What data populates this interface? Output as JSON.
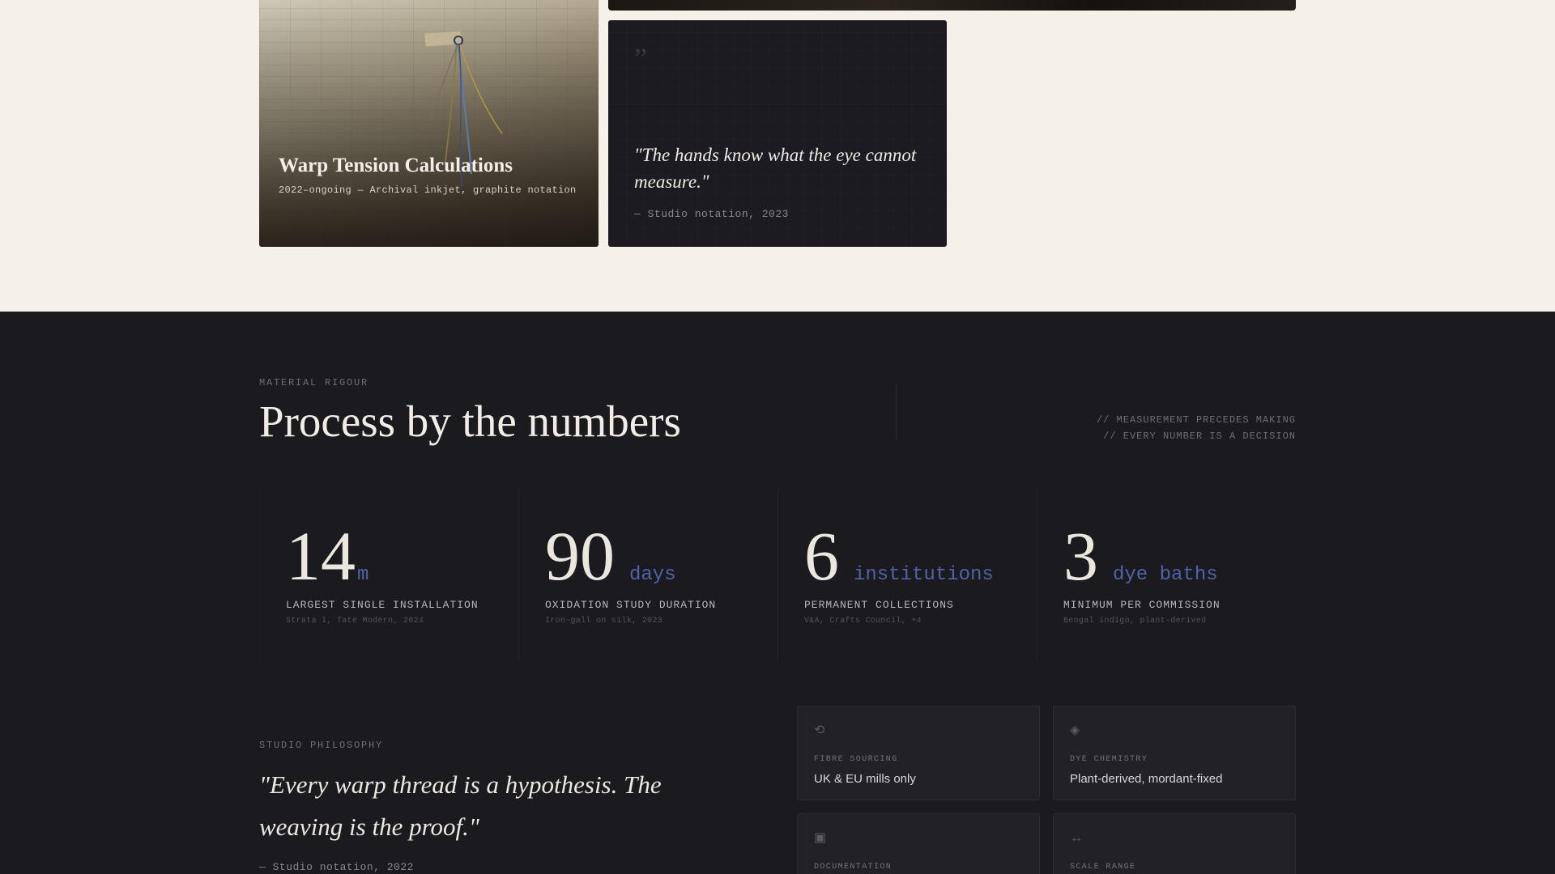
{
  "gallery": {
    "photo_card": {
      "title": "Warp Tension Calculations",
      "meta": "2022–ongoing — Archival inkjet, graphite notation"
    },
    "quote_card": {
      "mark": "”",
      "text": "\"The hands know what the eye cannot measure.\"",
      "source": "— Studio notation, 2023"
    }
  },
  "process": {
    "eyebrow": "MATERIAL RIGOUR",
    "title": "Process by the numbers",
    "notes": [
      "// MEASUREMENT PRECEDES MAKING",
      "// EVERY NUMBER IS A DECISION"
    ],
    "stats": [
      {
        "value": "14",
        "unit": "m",
        "label": "LARGEST SINGLE INSTALLATION",
        "sub": "Strata I, Tate Modern, 2024"
      },
      {
        "value": "90",
        "unit": "days",
        "label": "OXIDATION STUDY DURATION",
        "sub": "Iron-gall on silk, 2023"
      },
      {
        "value": "6",
        "unit": "institutions",
        "label": "PERMANENT COLLECTIONS",
        "sub": "V&A, Crafts Council, +4"
      },
      {
        "value": "3",
        "unit": "dye baths",
        "label": "MINIMUM PER COMMISSION",
        "sub": "Bengal indigo, plant-derived"
      }
    ]
  },
  "philosophy": {
    "eyebrow": "STUDIO PHILOSOPHY",
    "quote": "\"Every warp thread is a hypothesis. The weaving is the proof.\"",
    "source": "— Studio notation, 2022",
    "specs": [
      {
        "icon": "cycle-icon",
        "glyph": "⟲",
        "label": "FIBRE SOURCING",
        "value": "UK & EU mills only"
      },
      {
        "icon": "diamond-icon",
        "glyph": "◈",
        "label": "DYE CHEMISTRY",
        "value": "Plant-derived, mordant-fixed"
      },
      {
        "icon": "square-icon",
        "glyph": "▣",
        "label": "DOCUMENTATION",
        "value": ""
      },
      {
        "icon": "arrows-icon",
        "glyph": "↔",
        "label": "SCALE RANGE",
        "value": ""
      }
    ]
  },
  "colors": {
    "cream": "#f5f0e8",
    "dark": "#1b1a1f",
    "accent": "#4f63a8"
  }
}
